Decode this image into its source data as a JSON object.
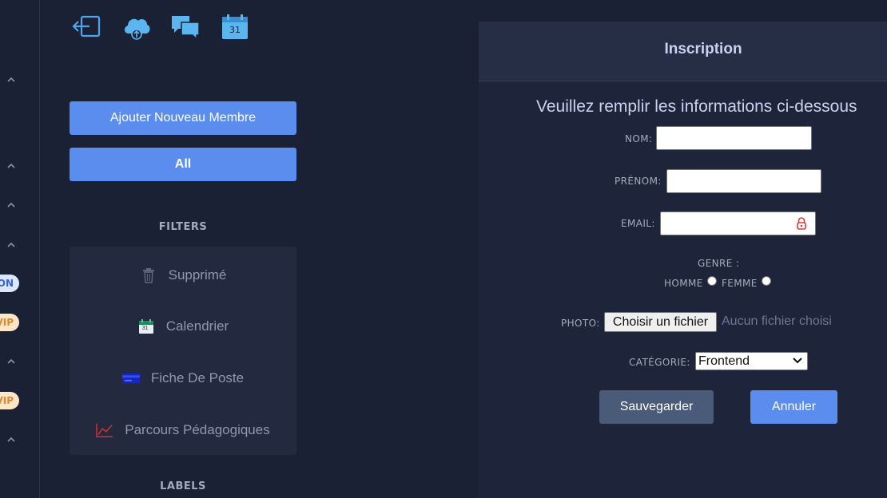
{
  "rail": {
    "badges": {
      "on": "ON",
      "vip1": "VIP",
      "vip2": "VIP"
    }
  },
  "toolbar": {
    "icons": [
      "logout-icon",
      "cloud-upload-icon",
      "chat-icon",
      "calendar-icon"
    ],
    "calendar_day": "31"
  },
  "sidebar": {
    "add_member_label": "Ajouter Nouveau Membre",
    "all_label": "All",
    "filters_title": "FILTERS",
    "labels_title": "LABELS",
    "filters": [
      {
        "label": "Supprimé",
        "icon": "trash-icon"
      },
      {
        "label": "Calendrier",
        "icon": "calendar-icon",
        "day": "31"
      },
      {
        "label": "Fiche De Poste",
        "icon": "card-icon"
      },
      {
        "label": "Parcours Pédagogiques",
        "icon": "chart-line-icon"
      }
    ]
  },
  "form": {
    "title": "Inscription",
    "subtitle": "Veuillez remplir les informations ci-dessous",
    "nom_label": "NOM:",
    "prenom_label": "PRÉNOM:",
    "email_label": "EMAIL:",
    "genre_label": "GENRE :",
    "homme_label": "HOMME",
    "femme_label": "FEMME",
    "photo_label": "PHOTO:",
    "file_button": "Choisir un fichier",
    "file_status": "Aucun fichier choisi",
    "categorie_label": "CATÉGORIE:",
    "categorie_value": "Frontend",
    "save_label": "Sauvegarder",
    "cancel_label": "Annuler"
  },
  "colors": {
    "background": "#1b2135",
    "primary": "#5b8dee",
    "secondary_button": "#4a5a79",
    "panel": "#232a40"
  }
}
